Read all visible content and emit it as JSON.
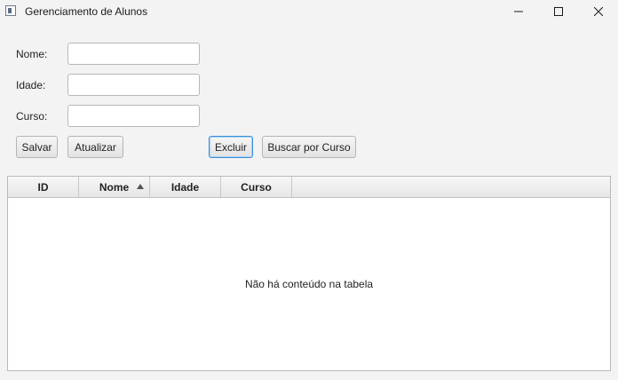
{
  "window": {
    "title": "Gerenciamento de Alunos",
    "controls": [
      "minimize-icon",
      "maximize-icon",
      "close-icon"
    ]
  },
  "form": {
    "nome_label": "Nome:",
    "nome_value": "",
    "idade_label": "Idade:",
    "idade_value": "",
    "curso_label": "Curso:",
    "curso_value": ""
  },
  "buttons": {
    "salvar": "Salvar",
    "atualizar": "Atualizar",
    "excluir": "Excluir",
    "buscar": "Buscar por Curso"
  },
  "table": {
    "columns": [
      "ID",
      "Nome",
      "Idade",
      "Curso"
    ],
    "sorted_column": "Nome",
    "sort_direction": "ascending",
    "rows": [],
    "empty_message": "Não há conteúdo na tabela"
  },
  "colors": {
    "background": "#f3f3f3",
    "focus_border": "#3c8fd8"
  }
}
